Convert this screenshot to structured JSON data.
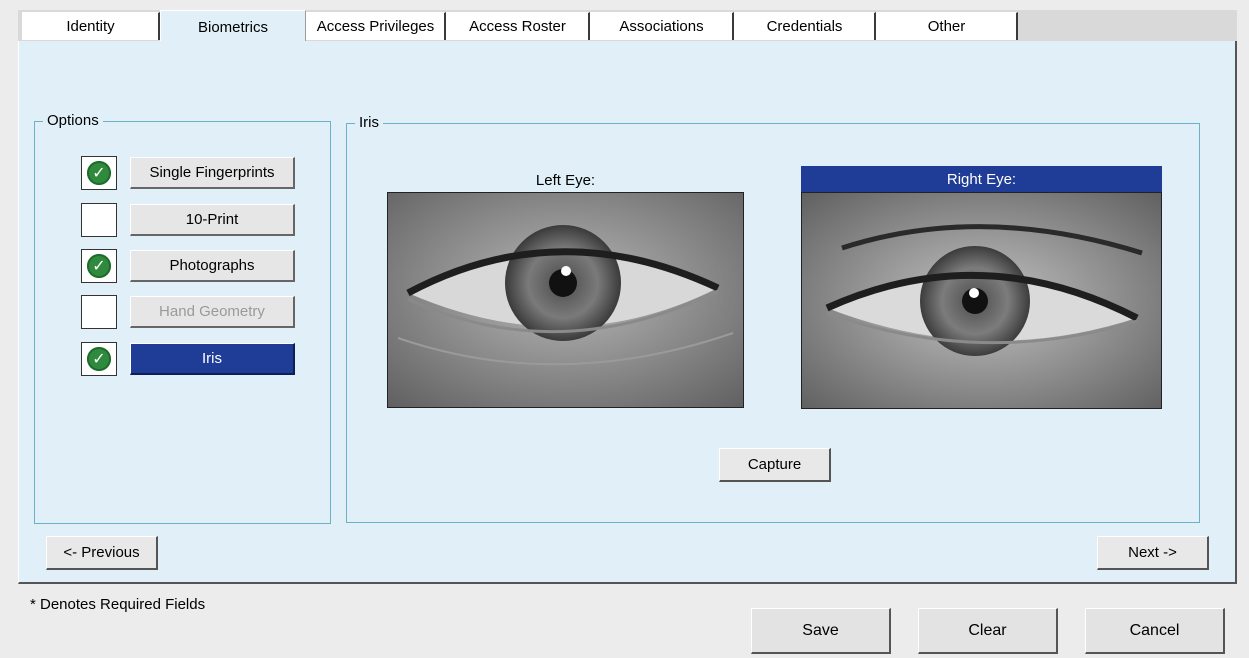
{
  "tabs": [
    {
      "label": "Identity"
    },
    {
      "label": "Biometrics",
      "active": true
    },
    {
      "label": "Access Privileges"
    },
    {
      "label": "Access Roster"
    },
    {
      "label": "Associations"
    },
    {
      "label": "Credentials"
    },
    {
      "label": "Other"
    }
  ],
  "options": {
    "title": "Options",
    "items": [
      {
        "label": "Single Fingerprints",
        "checked": true,
        "state": "normal"
      },
      {
        "label": "10-Print",
        "checked": false,
        "state": "normal"
      },
      {
        "label": "Photographs",
        "checked": true,
        "state": "normal"
      },
      {
        "label": "Hand Geometry",
        "checked": false,
        "state": "disabled"
      },
      {
        "label": "Iris",
        "checked": true,
        "state": "selected"
      }
    ]
  },
  "iris": {
    "title": "Iris",
    "left_label": "Left Eye:",
    "right_label": "Right Eye:",
    "capture_label": "Capture"
  },
  "nav": {
    "previous_label": "<- Previous",
    "next_label": "Next ->"
  },
  "footer": {
    "required_note": "* Denotes Required Fields",
    "save_label": "Save",
    "clear_label": "Clear",
    "cancel_label": "Cancel"
  },
  "colors": {
    "panel_bg": "#e1f0f8",
    "selected": "#1f3d97",
    "group_border": "#6ab3c3",
    "check_green": "#2f8a3e"
  }
}
